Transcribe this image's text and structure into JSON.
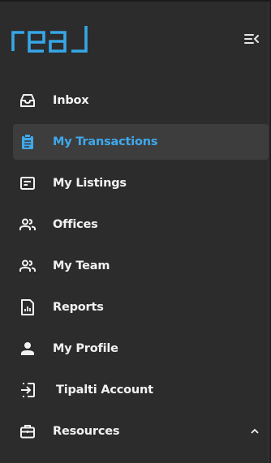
{
  "brand": {
    "logo_text": "real",
    "accent_color": "#36a6e8"
  },
  "header": {
    "collapse_icon": "collapse-menu-icon"
  },
  "nav": {
    "items": [
      {
        "label": "Inbox",
        "icon": "inbox-icon",
        "active": false
      },
      {
        "label": "My Transactions",
        "icon": "clipboard-icon",
        "active": true
      },
      {
        "label": "My Listings",
        "icon": "listing-icon",
        "active": false
      },
      {
        "label": "Offices",
        "icon": "people-icon",
        "active": false
      },
      {
        "label": "My Team",
        "icon": "team-icon",
        "active": false
      },
      {
        "label": "Reports",
        "icon": "report-icon",
        "active": false
      },
      {
        "label": "My Profile",
        "icon": "person-icon",
        "active": false
      },
      {
        "label": "Tipalti Account",
        "icon": "login-icon",
        "active": false
      },
      {
        "label": "Resources",
        "icon": "briefcase-icon",
        "active": false,
        "expanded": true
      }
    ]
  },
  "colors": {
    "background": "#2c2c2c",
    "active_bg": "#3d3d3d",
    "active_text": "#3fa9ec",
    "text": "#f2f2f2"
  }
}
